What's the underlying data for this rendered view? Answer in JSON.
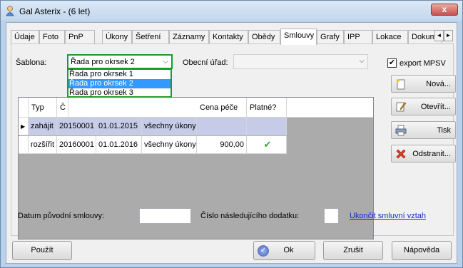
{
  "window": {
    "title": "Gal Asterix - (6 let)",
    "close_label": "x"
  },
  "tabs": [
    {
      "label": "Údaje"
    },
    {
      "label": "Foto"
    },
    {
      "label": "PnP"
    },
    {
      "label": "Úkony"
    },
    {
      "label": "Šetření"
    },
    {
      "label": "Záznamy"
    },
    {
      "label": "Kontakty"
    },
    {
      "label": "Obědy"
    },
    {
      "label": "Smlouvy",
      "active": true
    },
    {
      "label": "Grafy"
    },
    {
      "label": "IPP"
    },
    {
      "label": "Lokace"
    },
    {
      "label": "Dokum"
    }
  ],
  "tab_scroll": {
    "left": "◄",
    "right": "►"
  },
  "form": {
    "sablona_label": "Šablona:",
    "sablona_value": "Řada pro okrsek 2",
    "sablona_options": [
      "Řada pro okrsek 1",
      "Řada pro okrsek 2",
      "Řada pro okrsek 3"
    ],
    "obecni_urad_label": "Obecní úřad:",
    "obecni_urad_value": "",
    "export_label": "export MPSV",
    "export_checked": "✔"
  },
  "grid": {
    "headers": [
      "Typ",
      "Č",
      "",
      "",
      "Cena péče",
      "Platné?"
    ],
    "row_indicator": "▶",
    "rows": [
      {
        "typ": "zahájit",
        "cislo": "20150001",
        "datum": "01.01.2015",
        "ukony": "všechny úkony",
        "cena": "",
        "platne": ""
      },
      {
        "typ": "rozšířit",
        "cislo": "20160001",
        "datum": "01.01.2016",
        "ukony": "všechny úkony",
        "cena": "900,00",
        "platne": "✔"
      }
    ]
  },
  "side_buttons": {
    "nova": "Nová...",
    "otevrit": "Otevřít...",
    "tisk": "Tisk",
    "odstranit": "Odstranit..."
  },
  "footer": {
    "datum_label": "Datum původní smlouvy:",
    "cislo_label": "Číslo následujícího dodatku:",
    "ukoncit_link": "Ukončit smluvní vztah"
  },
  "buttons": {
    "pouzit": "Použít",
    "ok": "Ok",
    "zrusit": "Zrušit",
    "napoveda": "Nápověda"
  },
  "colors": {
    "focus_green": "#1a9c2a",
    "selected_row": "#c6cbe8",
    "check_green": "#3aa03a",
    "link_blue": "#0033cc"
  }
}
